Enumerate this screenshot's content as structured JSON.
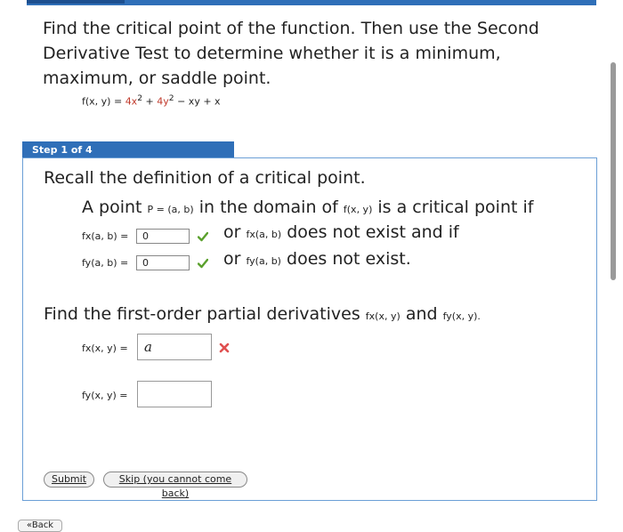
{
  "problem": {
    "text": "Find the critical point of the function. Then use the Second Derivative Test to determine whether it is a minimum, maximum, or saddle point.",
    "function_prefix": "f(x, y) = ",
    "term1": "4x",
    "term2": "4y",
    "function_rest": " − xy + x"
  },
  "step": {
    "label": "Step 1 of 4",
    "recall": "Recall the definition of a critical point.",
    "definition": {
      "a_point": "A point",
      "point_expr": "P = (a, b)",
      "domain": "in the domain of",
      "f_expr": "f(x, y)",
      "is_critical": "is a critical point if",
      "fx_label": "fx(a, b) =",
      "fx_value": "0",
      "fx_or": "or",
      "fx_expr": "fx(a, b)",
      "fx_tail": "does not exist and if",
      "fy_label": "fy(a, b) =",
      "fy_value": "0",
      "fy_or": "or",
      "fy_expr": "fy(a, b)",
      "fy_tail": "does not exist."
    },
    "find": {
      "text": "Find the first-order partial derivatives",
      "fx_expr": "fx(x, y)",
      "and": "and",
      "fy_expr": "fy(x, y).",
      "fx_label": "fx(x, y) =",
      "fx_value": "a",
      "fy_label": "fy(x, y) =",
      "fy_value": ""
    }
  },
  "buttons": {
    "submit": "Submit",
    "skip": "Skip (you cannot come back)",
    "back": "«Back"
  },
  "colors": {
    "accent": "#2f6fb8",
    "check": "#5aa02c",
    "error": "#e05050"
  }
}
